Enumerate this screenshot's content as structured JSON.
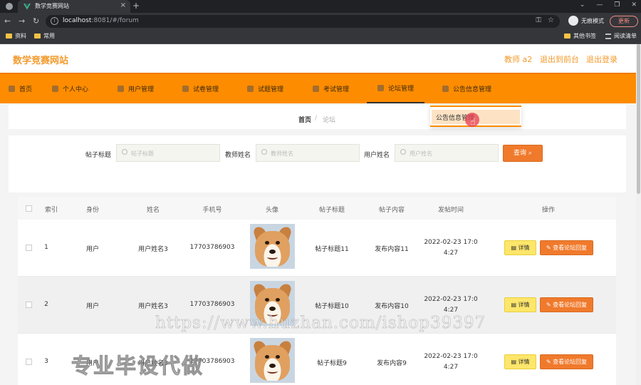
{
  "browser": {
    "tab_title": "数学竞赛网站",
    "tab_close": "×",
    "new_tab": "+",
    "url_host": "localhost",
    "url_rest": ":8081/#/forum",
    "incognito_label": "无痕模式",
    "update_label": "更新",
    "bookmarks": [
      "资料",
      "常用"
    ],
    "bookmarks_right": [
      "其他书签",
      "阅读清单"
    ]
  },
  "header": {
    "site_title": "数学竞赛网站",
    "user": "教师 a2",
    "to_front": "退出到前台",
    "logout": "退出登录"
  },
  "nav": {
    "items": [
      "首页",
      "个人中心",
      "用户管理",
      "试卷管理",
      "试题管理",
      "考试管理",
      "论坛管理",
      "公告信息管理"
    ],
    "active_index": 6
  },
  "dropdown": {
    "item": "公告信息管理"
  },
  "breadcrumb": {
    "home": "首页",
    "separator": "/",
    "current": "论坛"
  },
  "search": {
    "title_label": "帖子标题",
    "title_placeholder": "帖子标题",
    "teacher_label": "教师姓名",
    "teacher_placeholder": "教师姓名",
    "user_label": "用户姓名",
    "user_placeholder": "用户姓名",
    "query_button": "查询"
  },
  "table": {
    "columns": [
      "索引",
      "身份",
      "姓名",
      "手机号",
      "头像",
      "帖子标题",
      "帖子内容",
      "发帖时间",
      "操作"
    ],
    "rows": [
      {
        "index": "1",
        "role": "用户",
        "name": "用户姓名3",
        "phone": "17703786903",
        "title": "帖子标题11",
        "content": "发布内容11",
        "time_a": "2022-02-23 17:0",
        "time_b": "4:27"
      },
      {
        "index": "2",
        "role": "用户",
        "name": "用户姓名3",
        "phone": "17703786903",
        "title": "帖子标题10",
        "content": "发布内容10",
        "time_a": "2022-02-23 17:0",
        "time_b": "4:27"
      },
      {
        "index": "3",
        "role": "用户",
        "name": "用户姓名3",
        "phone": "17703786903",
        "title": "帖子标题9",
        "content": "发布内容9",
        "time_a": "2022-02-23 17:0",
        "time_b": "4:27"
      }
    ],
    "detail_button": "详情",
    "reply_button": "查看论坛回复"
  },
  "watermark": {
    "url": "https://www.huzhan.com/ishop39397",
    "text": "专业毕设代做"
  },
  "colors": {
    "accent": "#fe8c00",
    "title": "#f39a2c",
    "button": "#f07a2c",
    "detail": "#fde66a"
  }
}
